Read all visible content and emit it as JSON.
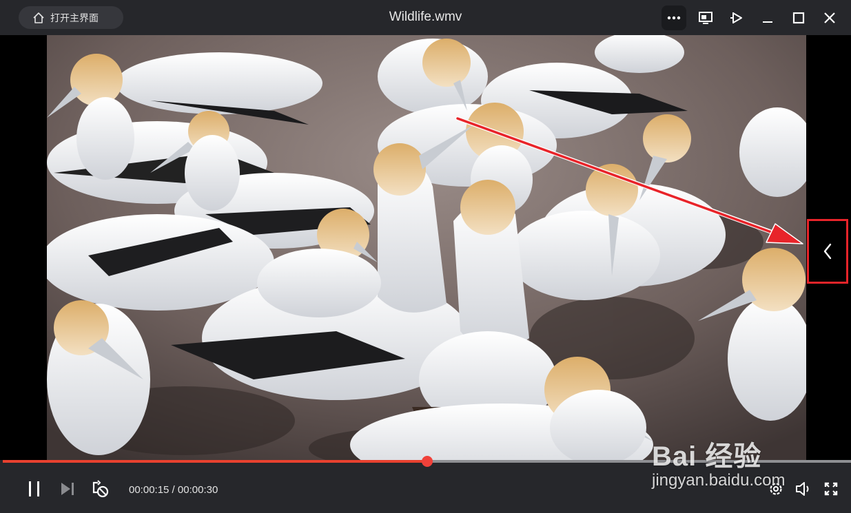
{
  "titlebar": {
    "home_label": "打开主界面",
    "title": "Wildlife.wmv",
    "controls": [
      "more-icon",
      "screen-capture-icon",
      "pin-icon",
      "minimize-icon",
      "maximize-icon",
      "close-icon"
    ]
  },
  "side_panel": {
    "toggle_icon": "chevron-left-icon",
    "highlight_color": "#e8242a"
  },
  "playback": {
    "current_time": "00:00:15",
    "separator": " / ",
    "duration": "00:00:30",
    "progress": 0.5,
    "progress_color": "#e8412f",
    "left_buttons": [
      "pause-icon",
      "next-icon",
      "loop-off-icon"
    ],
    "right_buttons": [
      "settings-icon",
      "volume-icon",
      "fullscreen-icon"
    ]
  },
  "watermark": {
    "logo": "Bai 经验",
    "url": "jingyan.baidu.com"
  },
  "colors": {
    "bar_bg": "#26272b",
    "accent": "#e8412f",
    "annotation": "#e8242a"
  }
}
